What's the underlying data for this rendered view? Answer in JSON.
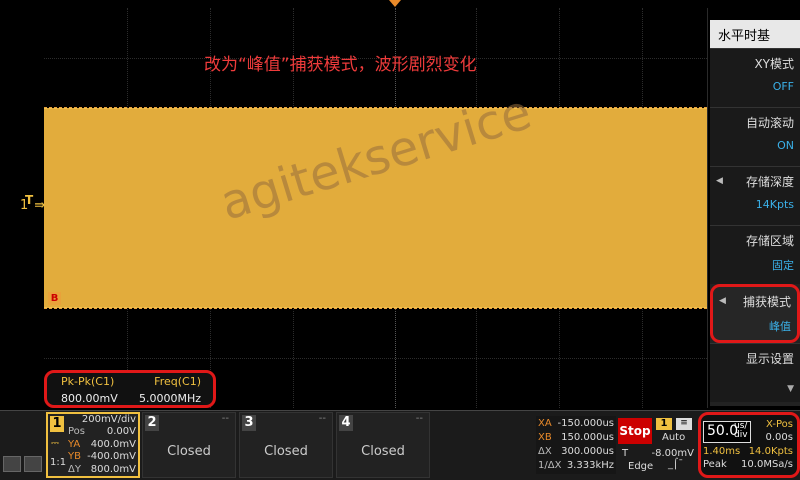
{
  "annotation": "改为“峰值”捕获模式，波形剧烈变化",
  "watermark": "agitekservice",
  "channel_marker": "1",
  "trigger_marker": "T",
  "cursor_b_label": "B",
  "measurements": {
    "headers": [
      "Pk-Pk(C1)",
      "Freq(C1)"
    ],
    "values": [
      "800.00mV",
      "5.0000MHz"
    ]
  },
  "menu": {
    "title": "水平时基",
    "items": [
      {
        "label": "XY模式",
        "value": "OFF"
      },
      {
        "label": "自动滚动",
        "value": "ON"
      },
      {
        "label": "存储深度",
        "value": "14Kpts"
      },
      {
        "label": "存储区域",
        "value": "固定"
      },
      {
        "label": "捕获模式",
        "value": "峰值"
      },
      {
        "label": "显示设置",
        "value": ""
      }
    ]
  },
  "channels": {
    "ch1": {
      "num": "1",
      "scale": "200mV/div",
      "pos_label": "Pos",
      "pos": "0.00V",
      "ya_label": "YA",
      "ya": "400.0mV",
      "yb_label": "YB",
      "yb": "-400.0mV",
      "dy_label": "ΔY",
      "dy": "800.0mV",
      "ratio": "1:1"
    },
    "ch2": {
      "num": "2",
      "state": "Closed",
      "dash": "--"
    },
    "ch3": {
      "num": "3",
      "state": "Closed",
      "dash": "--"
    },
    "ch4": {
      "num": "4",
      "state": "Closed",
      "dash": "--"
    }
  },
  "cursors": {
    "xa_label": "XA",
    "xa": "-150.000us",
    "xb_label": "XB",
    "xb": "150.000us",
    "dx_label": "ΔX",
    "dx": "300.000us",
    "inv_label": "1/ΔX",
    "inv": "3.333kHz"
  },
  "run_state": "Stop",
  "trigger": {
    "source": "1",
    "mode": "Auto",
    "t_label": "T",
    "level": "-8.00mV",
    "type": "Edge"
  },
  "timebase": {
    "scale": "50.0",
    "unit_top": "us/",
    "unit_bot": "div",
    "xpos_label": "X-Pos",
    "xpos": "0.00s",
    "window": "1.40ms",
    "depth": "14.0Kpts",
    "mode": "Peak",
    "rate": "10.0MSa/s"
  },
  "colors": {
    "waveform": "#e2ac3c",
    "highlight": "#e01818",
    "menu_value": "#3ab0e8"
  }
}
